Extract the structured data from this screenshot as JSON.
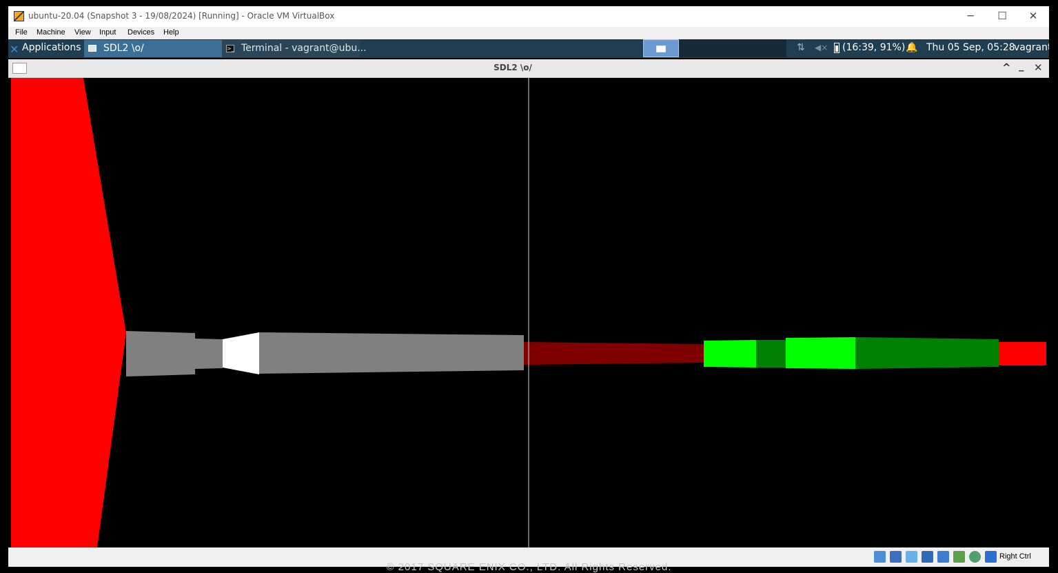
{
  "vbox": {
    "title": "ubuntu-20.04 (Snapshot 3 - 19/08/2024) [Running] - Oracle VM VirtualBox",
    "controls": {
      "minimize": "─",
      "maximize": "☐",
      "close": "✕"
    },
    "menu": [
      "File",
      "Machine",
      "View",
      "Input",
      "Devices",
      "Help"
    ],
    "status_host_key": "Right Ctrl",
    "status_icons": [
      "optical-drive-icon",
      "network-icon",
      "shared-folder-icon",
      "display-icon",
      "usb-icon",
      "recording-icon",
      "mouse-integration-icon",
      "cpu-icon",
      "host-key-icon"
    ]
  },
  "panel": {
    "applications_label": "Applications",
    "tasks": [
      {
        "label": "SDL2 \\o/",
        "active": true
      },
      {
        "label": "Terminal - vagrant@ubu...",
        "active": false
      }
    ],
    "battery_label": "(16:39, 91%)",
    "clock": "Thu 05 Sep, 05:28",
    "user": "vagrant"
  },
  "sdl_window": {
    "title": "SDL2 \\o/",
    "controls": {
      "shade": "^",
      "minimize": "_",
      "close": "✕"
    }
  },
  "footer_overlay": "© 2017 SQUARE ENIX CO., LTD. All Rights Reserved.",
  "colors": {
    "panel": "#1f3e51",
    "red": "#ff0000",
    "gray": "#808080",
    "white": "#ffffff",
    "dark_red": "#800000",
    "bright_green": "#00ff00",
    "dark_green": "#008000"
  }
}
